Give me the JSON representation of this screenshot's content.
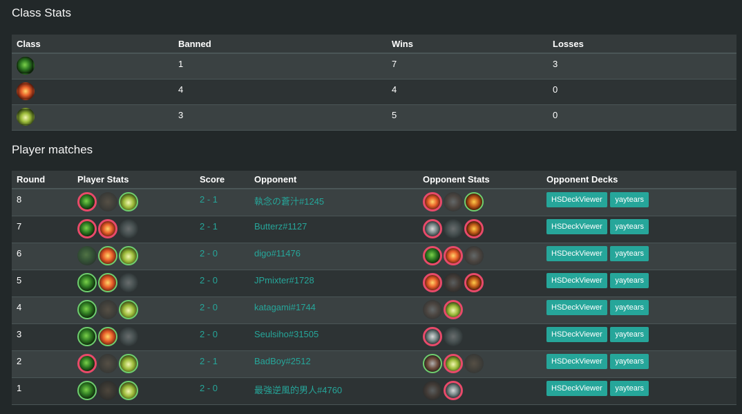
{
  "class_stats": {
    "title": "Class Stats",
    "headers": [
      "Class",
      "Banned",
      "Wins",
      "Losses"
    ],
    "rows": [
      {
        "class_icon": "hunter-icon",
        "banned": "1",
        "wins": "7",
        "losses": "3"
      },
      {
        "class_icon": "mage-icon",
        "banned": "4",
        "wins": "4",
        "losses": "0"
      },
      {
        "class_icon": "druid-icon",
        "banned": "3",
        "wins": "5",
        "losses": "0"
      }
    ]
  },
  "player_matches": {
    "title": "Player matches",
    "headers": [
      "Round",
      "Player Stats",
      "Score",
      "Opponent",
      "Opponent Stats",
      "Opponent Decks"
    ],
    "deck_buttons": [
      "HSDeckViewer",
      "yaytears"
    ],
    "rows": [
      {
        "round": "8",
        "score": "2 - 1",
        "opponent": "執念の蒼汁#1245"
      },
      {
        "round": "7",
        "score": "2 - 1",
        "opponent": "Butterz#1127"
      },
      {
        "round": "6",
        "score": "2 - 0",
        "opponent": "digo#11476"
      },
      {
        "round": "5",
        "score": "2 - 0",
        "opponent": "JPmixter#1728"
      },
      {
        "round": "4",
        "score": "2 - 0",
        "opponent": "katagami#1744"
      },
      {
        "round": "3",
        "score": "2 - 0",
        "opponent": "Seulsiho#31505"
      },
      {
        "round": "2",
        "score": "2 - 1",
        "opponent": "BadBoy#2512"
      },
      {
        "round": "1",
        "score": "2 - 0",
        "opponent": "最強逆風的男人#4760"
      }
    ]
  },
  "colors": {
    "background": "#222829",
    "accent": "#26a69a",
    "win_ring": "#6fcf6f",
    "loss_ring": "#e84a6a"
  }
}
